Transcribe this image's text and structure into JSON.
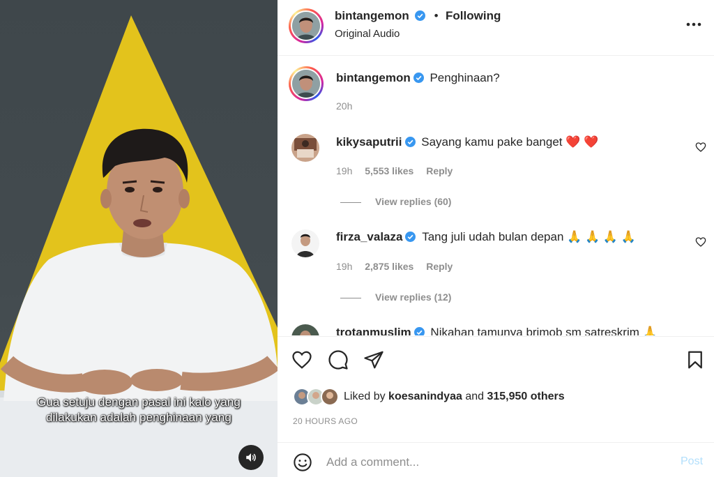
{
  "video": {
    "subtitle_line1": "Gua setuju dengan pasal ini kalo yang",
    "subtitle_line2": "dilakukan adalah penghinaan yang",
    "mute_icon": "speaker-icon"
  },
  "header": {
    "username": "bintangemon",
    "separator": "•",
    "follow_status": "Following",
    "audio": "Original Audio",
    "more_icon": "more-horizontal-icon"
  },
  "caption": {
    "username": "bintangemon",
    "text": "Penghinaan?",
    "time": "20h"
  },
  "comments": [
    {
      "username": "kikysaputrii",
      "text": "Sayang kamu pake banget ❤️ ❤️",
      "time": "19h",
      "likes": "5,553 likes",
      "reply_label": "Reply",
      "view_replies": "View replies (60)"
    },
    {
      "username": "firza_valaza",
      "text": "Tang juli udah bulan depan 🙏 🙏 🙏 🙏",
      "time": "19h",
      "likes": "2,875 likes",
      "reply_label": "Reply",
      "view_replies": "View replies (12)"
    },
    {
      "username": "trotanmuslim",
      "text": "Nikahan tamunya brimob sm satreskrim 🙏"
    }
  ],
  "actions": {
    "liked_prefix": "Liked by",
    "liked_user": "koesanindyaa",
    "liked_and": "and",
    "liked_others": "315,950 others",
    "timestamp": "20 HOURS AGO"
  },
  "add_comment": {
    "placeholder": "Add a comment...",
    "post_label": "Post"
  },
  "colors": {
    "verified": "#3897f0",
    "heart_red": "#ed4956",
    "post_disabled": "#b2dffc",
    "muted_text": "#8e8e8e",
    "triangle_yellow": "#e8c51a"
  }
}
